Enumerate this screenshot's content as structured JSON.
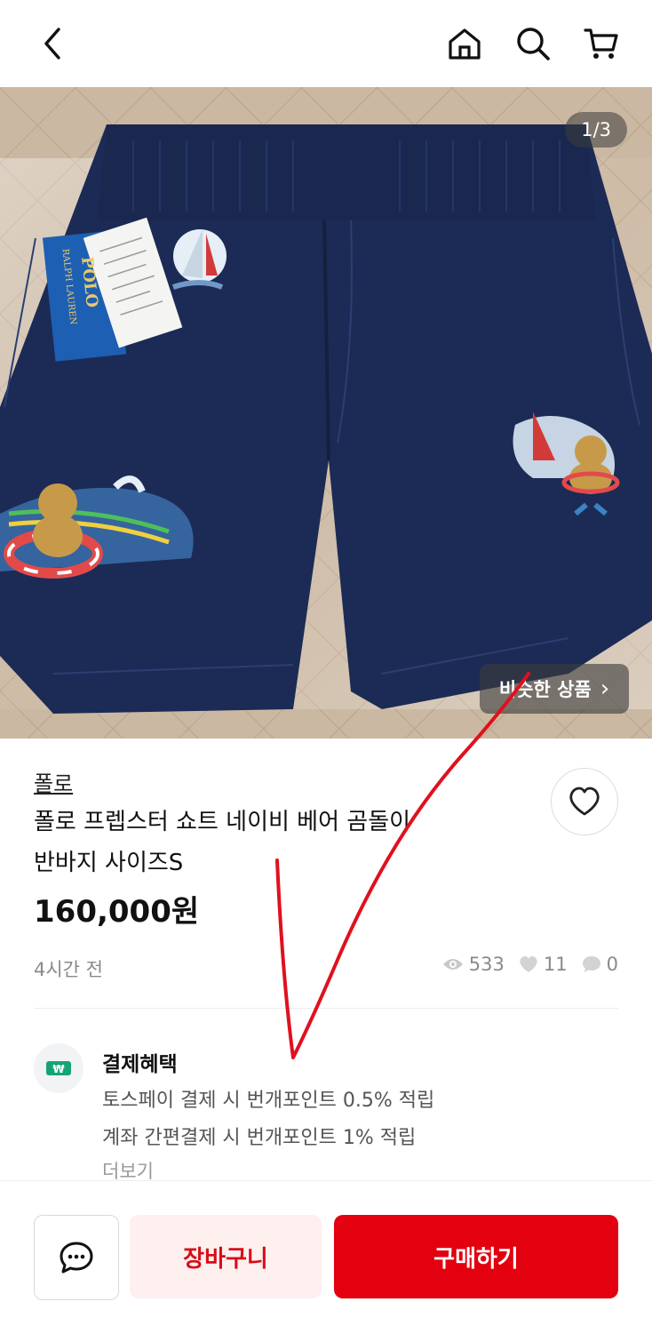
{
  "header": {
    "back_icon": "chevron-left-icon",
    "home_icon": "home-icon",
    "search_icon": "search-icon",
    "cart_icon": "cart-icon"
  },
  "gallery": {
    "counter": "1/3",
    "similar_label": "비슷한 상품",
    "similar_arrow": "›",
    "tag_brand": "POLO",
    "tag_sub": "RALPH LAUREN"
  },
  "product": {
    "brand": "폴로",
    "title_line1": "폴로 프렙스터 쇼트 네이비 베어 곰돌이",
    "title_line2": "반바지 사이즈S",
    "price": "160,000원",
    "time_ago": "4시간 전",
    "views": "533",
    "likes": "11",
    "chats": "0"
  },
  "benefit": {
    "title": "결제혜택",
    "line1": "토스페이 결제 시 번개포인트 0.5% 적립",
    "line2": "계좌 간편결제 시 번개포인트 1% 적립",
    "more": "더보기"
  },
  "actions": {
    "cart_label": "장바구니",
    "buy_label": "구매하기"
  },
  "colors": {
    "brand_red": "#e3000f",
    "cart_bg": "#fdf0ef",
    "shorts_navy": "#1c2b55",
    "annotation_red": "#e0101e"
  }
}
